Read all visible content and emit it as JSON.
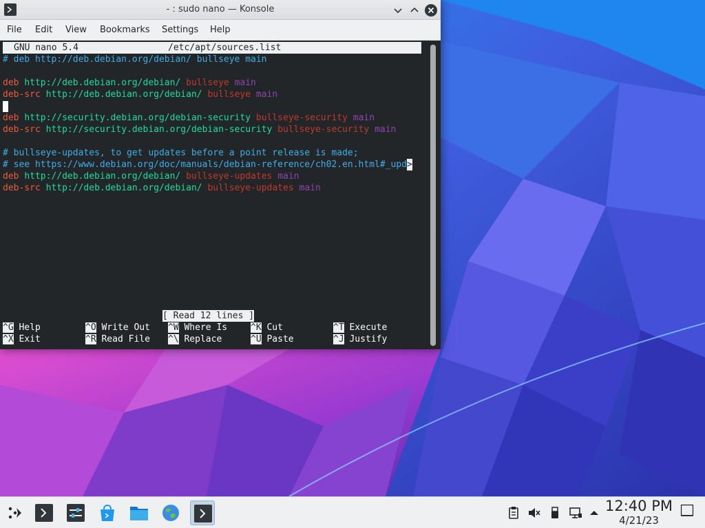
{
  "window": {
    "title": "- : sudo nano — Konsole",
    "menu": [
      "File",
      "Edit",
      "View",
      "Bookmarks",
      "Settings",
      "Help"
    ]
  },
  "nano": {
    "header_left": "GNU nano 5.4",
    "header_file": "/etc/apt/sources.list",
    "status": "[ Read 12 lines ]",
    "lines": [
      {
        "comment": "# deb http://deb.debian.org/debian/ bullseye main"
      },
      {
        "type": "deb",
        "url": "http://deb.debian.org/debian/",
        "suite": "bullseye",
        "comp": "main"
      },
      {
        "type": "deb-src",
        "url": "http://deb.debian.org/debian/",
        "suite": "bullseye",
        "comp": "main"
      },
      {
        "type": "deb",
        "url": "http://security.debian.org/debian-security",
        "suite": "bullseye-security",
        "comp": "main"
      },
      {
        "type": "deb-src",
        "url": "http://security.debian.org/debian-security",
        "suite": "bullseye-security",
        "comp": "main"
      },
      {
        "comment": "# bullseye-updates, to get updates before a point release is made;"
      },
      {
        "comment": "# see https://www.debian.org/doc/manuals/debian-reference/ch02.en.html#_upd",
        "overflow": ">"
      },
      {
        "type": "deb",
        "url": "http://deb.debian.org/debian/",
        "suite": "bullseye-updates",
        "comp": "main"
      },
      {
        "type": "deb-src",
        "url": "http://deb.debian.org/debian/",
        "suite": "bullseye-updates",
        "comp": "main"
      }
    ],
    "shortcuts": [
      {
        "key": "^G",
        "label": "Help"
      },
      {
        "key": "^X",
        "label": "Exit"
      },
      {
        "key": "^O",
        "label": "Write Out"
      },
      {
        "key": "^R",
        "label": "Read File"
      },
      {
        "key": "^W",
        "label": "Where Is"
      },
      {
        "key": "^\\",
        "label": "Replace"
      },
      {
        "key": "^K",
        "label": "Cut"
      },
      {
        "key": "^U",
        "label": "Paste"
      },
      {
        "key": "^T",
        "label": "Execute"
      },
      {
        "key": "^J",
        "label": "Justify"
      }
    ]
  },
  "taskbar": {
    "clock_time": "12:40 PM",
    "clock_date": "4/21/23",
    "apps": [
      "application-launcher-icon",
      "konsole-icon",
      "system-settings-icon",
      "discover-store-icon",
      "dolphin-files-icon",
      "firefox-globe-icon",
      "konsole-active-icon"
    ],
    "tray": [
      "clipboard-icon",
      "volume-muted-icon",
      "usb-device-icon",
      "network-wired-icon",
      "tray-expand-icon",
      "show-desktop-icon"
    ]
  },
  "colors": {
    "comment": "#3daee9",
    "deb_keyword": "#ed5a3b",
    "url": "#1cdc9a",
    "suite": "#c0392b",
    "component": "#8e44ad",
    "terminal_bg": "#232629"
  }
}
